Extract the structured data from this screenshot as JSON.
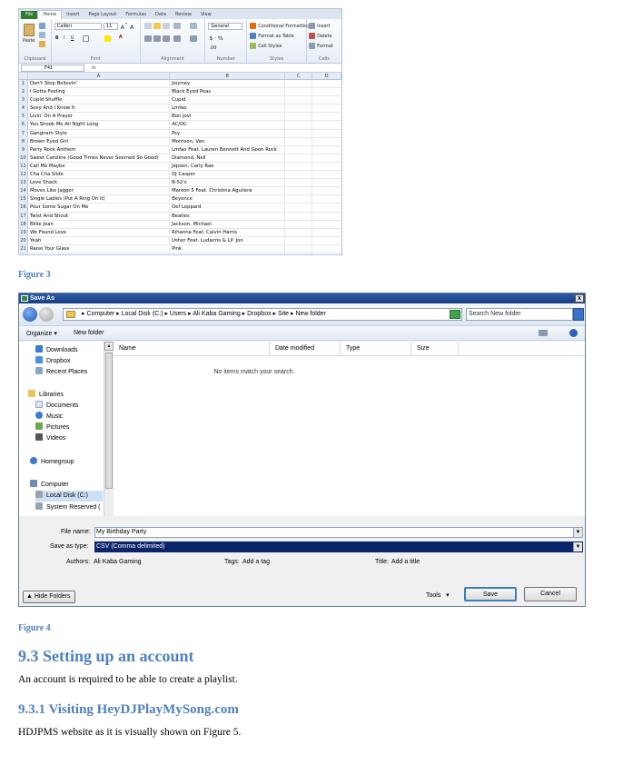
{
  "excel": {
    "tabs": [
      "File",
      "Home",
      "Insert",
      "Page Layout",
      "Formulas",
      "Data",
      "Review",
      "View"
    ],
    "active_tab": "Home",
    "ribbon": {
      "paste_label": "Paste",
      "font_name": "Calibri",
      "font_size": "11",
      "number_format": "General",
      "conditional_formatting": "Conditional Formatting",
      "format_as_table": "Format as Table",
      "cell_styles": "Cell Styles",
      "insert": "Insert",
      "delete": "Delete",
      "format": "Format",
      "groups": [
        "Clipboard",
        "Font",
        "Alignment",
        "Number",
        "Styles",
        "Cells"
      ]
    },
    "name_box": "F41",
    "fx": "fx",
    "columns": [
      "A",
      "B",
      "C",
      "D"
    ],
    "rows": [
      {
        "n": "1",
        "a": "Don't Stop Believin'",
        "b": "Journey"
      },
      {
        "n": "2",
        "a": "I Gotta Feeling",
        "b": "Black Eyed Peas"
      },
      {
        "n": "3",
        "a": "Cupid Shuffle",
        "b": "Cupid"
      },
      {
        "n": "4",
        "a": "Sexy And I Know It",
        "b": "Lmfao"
      },
      {
        "n": "5",
        "a": "Livin' On A Prayer",
        "b": "Bon Jovi"
      },
      {
        "n": "6",
        "a": "You Shook Me All Night Long",
        "b": "AC/DC"
      },
      {
        "n": "7",
        "a": "Gangnam Style",
        "b": "Psy"
      },
      {
        "n": "8",
        "a": "Brown Eyed Girl",
        "b": "Morrison, Van"
      },
      {
        "n": "9",
        "a": "Party Rock Anthem",
        "b": "Lmfao Feat. Lauren Bennett And Goon Rock"
      },
      {
        "n": "10",
        "a": "Sweet Caroline (Good Times Never Seemed So Good)",
        "b": "Diamond, Neil"
      },
      {
        "n": "11",
        "a": "Call Me Maybe",
        "b": "Jepsen, Carly Rae"
      },
      {
        "n": "12",
        "a": "Cha Cha Slide",
        "b": "DJ Casper"
      },
      {
        "n": "13",
        "a": "Love Shack",
        "b": "B-52's"
      },
      {
        "n": "14",
        "a": "Moves Like Jagger",
        "b": "Maroon 5 Feat. Christina Aguilera"
      },
      {
        "n": "15",
        "a": "Single Ladies (Put A Ring On It)",
        "b": "Beyonce"
      },
      {
        "n": "16",
        "a": "Pour Some Sugar On Me",
        "b": "Def Leppard"
      },
      {
        "n": "17",
        "a": "Twist And Shout",
        "b": "Beatles"
      },
      {
        "n": "18",
        "a": "Billie Jean",
        "b": "Jackson, Michael"
      },
      {
        "n": "19",
        "a": "We Found Love",
        "b": "Rihanna Feat. Calvin Harris"
      },
      {
        "n": "20",
        "a": "Yeah",
        "b": "Usher Feat. Ludacris & Lil' Jon"
      },
      {
        "n": "21",
        "a": "Raise Your Glass",
        "b": "Pink"
      },
      {
        "n": "22",
        "a": "Wobble",
        "b": "V.I.C."
      }
    ]
  },
  "figure3": "Figure 3",
  "dialog": {
    "title": "Save As",
    "close": "x",
    "breadcrumb": "▸ Computer ▸ Local Disk (C:) ▸ Users ▸ Ali Kaba Gaming ▸ Dropbox ▸ Site ▸ New folder",
    "search_placeholder": "Search New folder",
    "organize": "Organize ▾",
    "new_folder": "New folder",
    "nav_items": [
      {
        "label": "Downloads"
      },
      {
        "label": "Dropbox"
      },
      {
        "label": "Recent Places"
      },
      {
        "label": "Libraries"
      },
      {
        "label": "Documents"
      },
      {
        "label": "Music"
      },
      {
        "label": "Pictures"
      },
      {
        "label": "Videos"
      },
      {
        "label": "Homegroup"
      },
      {
        "label": "Computer"
      },
      {
        "label": "Local Disk (C:)"
      },
      {
        "label": "System Reserved ("
      }
    ],
    "columns": [
      "Name",
      "Date modified",
      "Type",
      "Size"
    ],
    "empty_message": "No items match your search.",
    "file_name_label": "File name:",
    "file_name": "My Birthday Party",
    "save_as_type_label": "Save as type:",
    "save_as_type": "CSV (Comma delimited)",
    "authors_label": "Authors:",
    "authors": "Ali Kaba Gaming",
    "tags_label": "Tags:",
    "tags": "Add a tag",
    "title_label": "Title:",
    "title_value": "Add a title",
    "hide_folders": "Hide Folders",
    "tools": "Tools",
    "save": "Save",
    "cancel": "Cancel"
  },
  "figure4": "Figure 4",
  "section_heading": "9.3 Setting up an account",
  "section_text": "An account is required to be able to create a playlist.",
  "subsection_heading": "9.3.1 Visiting HeyDJPlayMySong.com",
  "subsection_text": "HDJPMS website as it is visually  shown on Figure 5."
}
